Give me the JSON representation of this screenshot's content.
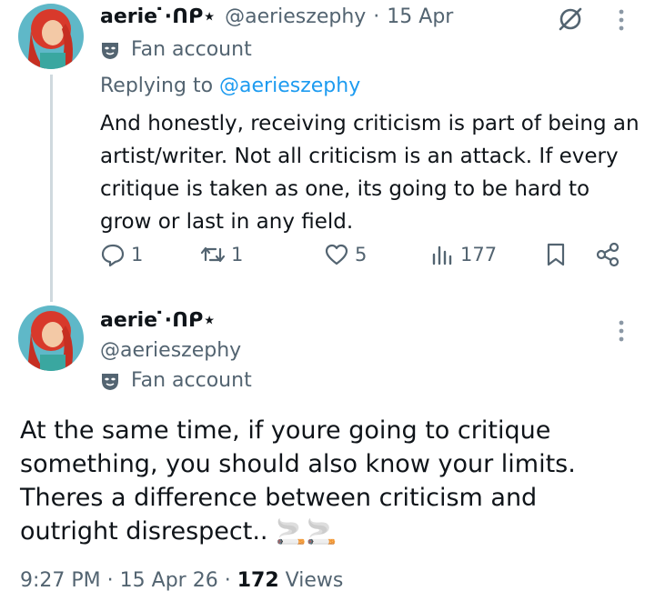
{
  "reply": {
    "display_name": "aerie ̇⋅ᑎᑭ⋆",
    "handle": "@aerieszephy",
    "separator": "·",
    "date": "15 Apr",
    "label": "Fan account",
    "replying_prefix": "Replying to",
    "replying_to": "@aerieszephy",
    "text": "And honestly, receiving criticism is part of being an artist/writer. Not all criticism is an attack. If every critique is taken as one, its going to be hard to grow or last in any field.",
    "stats": {
      "replies": "1",
      "reposts": "1",
      "likes": "5",
      "views": "177"
    }
  },
  "main": {
    "display_name": "aerie ̇⋅ᑎᑭ⋆",
    "handle": "@aerieszephy",
    "label": "Fan account",
    "text": "At the same time, if youre going to critique something, you should also know your limits. Theres a difference between criticism and outright disrespect..",
    "emoji": "🚬🚬",
    "time": "9:27 PM",
    "date": "15 Apr 26",
    "views_count": "172",
    "views_label": "Views",
    "separator": "·"
  },
  "colors": {
    "text_primary": "#0f1419",
    "text_secondary": "#536471",
    "link": "#1d9bf0",
    "thread_line": "#cfd9de"
  },
  "icons": [
    "avatar",
    "mask-icon",
    "grok-icon",
    "more-icon",
    "reply-icon",
    "repost-icon",
    "like-icon",
    "views-icon",
    "bookmark-icon",
    "share-icon"
  ]
}
